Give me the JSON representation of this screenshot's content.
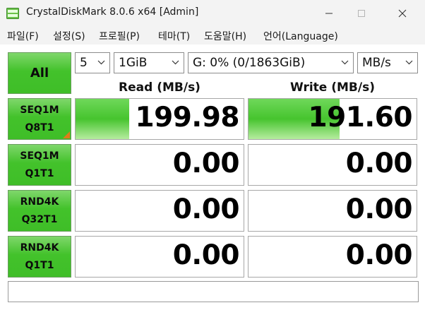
{
  "window": {
    "title": "CrystalDiskMark 8.0.6 x64 [Admin]"
  },
  "menu": [
    {
      "label": "파일(F)"
    },
    {
      "label": "설정(S)"
    },
    {
      "label": "프로필(P)"
    },
    {
      "label": "테마(T)"
    },
    {
      "label": "도움말(H)"
    },
    {
      "label": "언어(Language)"
    }
  ],
  "controls": {
    "all_label": "All",
    "count": "5",
    "size": "1GiB",
    "drive": "G: 0% (0/1863GiB)",
    "unit": "MB/s"
  },
  "columns": {
    "read": "Read (MB/s)",
    "write": "Write (MB/s)"
  },
  "tests": [
    {
      "line1": "SEQ1M",
      "line2": "Q8T1",
      "read": "199.98",
      "write": "191.60",
      "read_level": 0.32,
      "write_level": 0.54
    },
    {
      "line1": "SEQ1M",
      "line2": "Q1T1",
      "read": "0.00",
      "write": "0.00",
      "read_level": 0,
      "write_level": 0
    },
    {
      "line1": "RND4K",
      "line2": "Q32T1",
      "read": "0.00",
      "write": "0.00",
      "read_level": 0,
      "write_level": 0
    },
    {
      "line1": "RND4K",
      "line2": "Q1T1",
      "read": "0.00",
      "write": "0.00",
      "read_level": 0,
      "write_level": 0
    }
  ],
  "colors": {
    "accent_green": "#43c22b",
    "marker_orange": "#e07a1a"
  },
  "icons": {
    "app": "disk-icon",
    "minimize": "minimize-icon",
    "maximize": "maximize-icon",
    "close": "close-icon",
    "dropdown": "chevron-down-icon"
  }
}
